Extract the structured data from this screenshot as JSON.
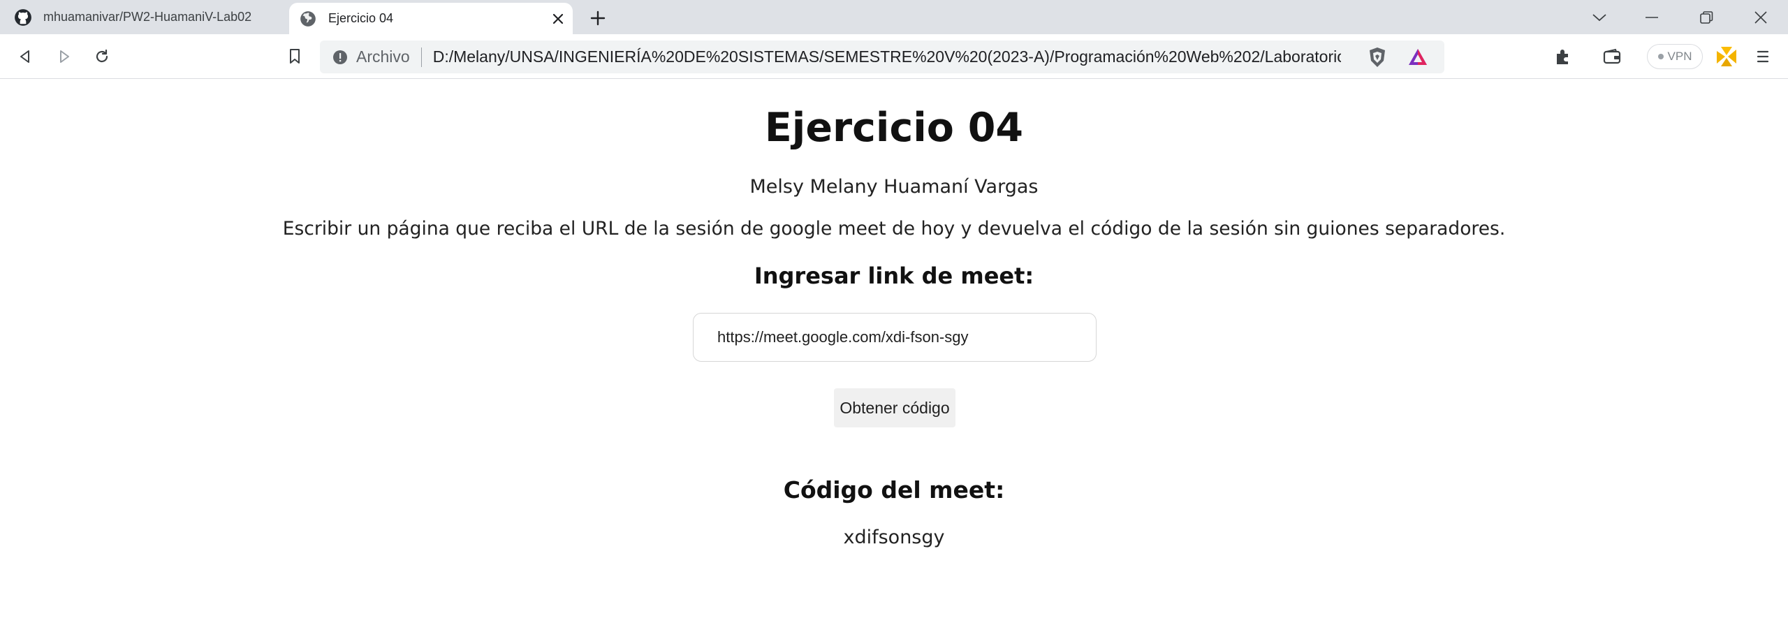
{
  "browser": {
    "tabs": [
      {
        "title": "mhuamanivar/PW2-HuamaniV-Lab02",
        "favicon": "github-icon",
        "active": false
      },
      {
        "title": "Ejercicio 04",
        "favicon": "globe-icon",
        "active": true
      }
    ],
    "address_bar": {
      "scheme_label": "Archivo",
      "url": "D:/Melany/UNSA/INGENIERÍA%20DE%20SISTEMAS/SEMESTRE%20V%20(2023-A)/Programación%20Web%202/Laboratorio..."
    },
    "vpn_label": "VPN",
    "accent_color": "#dee1e6"
  },
  "page": {
    "title": "Ejercicio 04",
    "author": "Melsy Melany Huamaní Vargas",
    "description": "Escribir un página que reciba el URL de la sesión de google meet de hoy y devuelva el código de la sesión sin guiones separadores.",
    "input_label": "Ingresar link de meet:",
    "input_value": "https://meet.google.com/xdi-fson-sgy",
    "button_label": "Obtener código",
    "result_label": "Código del meet:",
    "result_value": "xdifsonsgy"
  }
}
